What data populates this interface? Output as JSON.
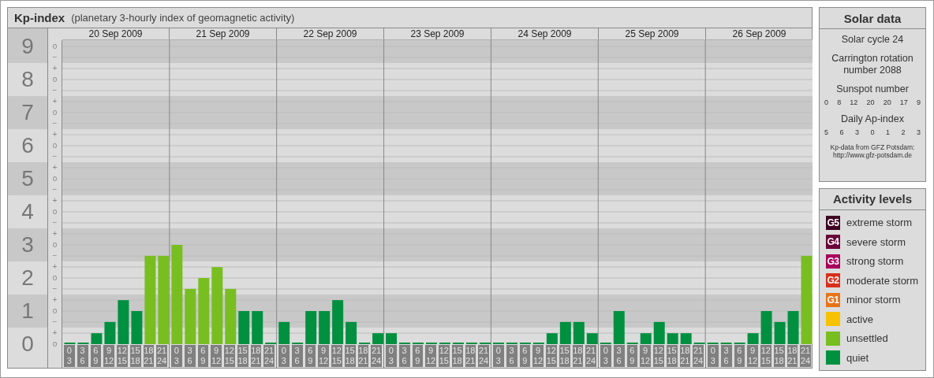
{
  "header": {
    "title": "Kp-index",
    "subtitle": "(planetary 3-hourly index of geomagnetic activity)"
  },
  "chart": {
    "days": [
      {
        "date": "20 Sep 2009"
      },
      {
        "date": "21 Sep 2009"
      },
      {
        "date": "22 Sep 2009"
      },
      {
        "date": "23 Sep 2009"
      },
      {
        "date": "24 Sep 2009"
      },
      {
        "date": "25 Sep 2009"
      },
      {
        "date": "26 Sep 2009"
      }
    ],
    "minor_ticks": [
      "o",
      "−",
      "+",
      "o",
      "−",
      "+",
      "o",
      "−",
      "+",
      "o",
      "−",
      "+",
      "o",
      "−",
      "+",
      "o",
      "−",
      "+",
      "o",
      "−",
      "+",
      "o",
      "−",
      "+",
      "o",
      "−",
      "+",
      "o"
    ],
    "chart_data": {
      "type": "bar",
      "ylim": [
        0,
        9
      ],
      "grid": true,
      "bands": [
        {
          "axis": "y",
          "from": 8.5,
          "to": 9.19,
          "color": "#c8c8c8"
        },
        {
          "axis": "y",
          "from": 6.5,
          "to": 7.5,
          "color": "#c8c8c8"
        },
        {
          "axis": "y",
          "from": 4.5,
          "to": 5.5,
          "color": "#c8c8c8"
        },
        {
          "axis": "y",
          "from": 2.5,
          "to": 3.5,
          "color": "#c8c8c8"
        },
        {
          "axis": "y",
          "from": 0.5,
          "to": 1.5,
          "color": "#c8c8c8"
        }
      ],
      "yticks": [
        9,
        8,
        7,
        6,
        5,
        4,
        3,
        2,
        1,
        0
      ],
      "categories": [
        "0\n3",
        "3\n6",
        "6\n9",
        "9\n12",
        "12\n15",
        "15\n18",
        "18\n21",
        "21\n24",
        "0\n3",
        "3\n6",
        "6\n9",
        "9\n12",
        "12\n15",
        "15\n18",
        "18\n21",
        "21\n24",
        "0\n3",
        "3\n6",
        "6\n9",
        "9\n12",
        "12\n15",
        "15\n18",
        "18\n21",
        "21\n24",
        "0\n3",
        "3\n6",
        "6\n9",
        "9\n12",
        "12\n15",
        "15\n18",
        "18\n21",
        "21\n24",
        "0\n3",
        "3\n6",
        "6\n9",
        "9\n12",
        "12\n15",
        "15\n18",
        "18\n21",
        "21\n24",
        "0\n3",
        "3\n6",
        "6\n9",
        "9\n12",
        "12\n15",
        "15\n18",
        "18\n21",
        "21\n24",
        "0\n3",
        "3\n6",
        "6\n9",
        "9\n12",
        "12\n15",
        "15\n18",
        "18\n21",
        "21\n24"
      ],
      "values": [
        0,
        0,
        0.33,
        0.67,
        1.33,
        1,
        2.67,
        2.67,
        3,
        1.67,
        2,
        2.33,
        1.67,
        1,
        1,
        0,
        0.67,
        0,
        1,
        1,
        1.33,
        0.67,
        0,
        0.33,
        0.33,
        0,
        0,
        0,
        0,
        0,
        0,
        0,
        0,
        0,
        0,
        0,
        0.33,
        0.67,
        0.67,
        0.33,
        0,
        1,
        0,
        0.33,
        0.67,
        0.33,
        0.33,
        0,
        0,
        0,
        0,
        0.33,
        1,
        0.67,
        1,
        2.67
      ]
    }
  },
  "solar": {
    "title": "Solar data",
    "cycle": "Solar cycle 24",
    "rotation": "Carrington rotation number 2088",
    "sunspot_label": "Sunspot number",
    "sunspots": [
      "0",
      "8",
      "12",
      "20",
      "20",
      "17",
      "9"
    ],
    "ap_label": "Daily Ap-index",
    "ap_values": [
      "5",
      "6",
      "3",
      "0",
      "1",
      "2",
      "3"
    ],
    "source": "Kp-data from GFZ Potsdam:",
    "source_url": "http://www.gfz-potsdam.de"
  },
  "legend": {
    "title": "Activity levels",
    "items": [
      {
        "badge": "G5",
        "label": "extreme storm",
        "color": "#3e0022"
      },
      {
        "badge": "G4",
        "label": "severe storm",
        "color": "#680038"
      },
      {
        "badge": "G3",
        "label": "strong storm",
        "color": "#a8005c"
      },
      {
        "badge": "G2",
        "label": "moderate storm",
        "color": "#d8301c"
      },
      {
        "badge": "G1",
        "label": "minor storm",
        "color": "#e8741a"
      },
      {
        "label": "active",
        "color": "#f8c200"
      },
      {
        "label": "unsettled",
        "color": "#78be20"
      },
      {
        "label": "quiet",
        "color": "#009040"
      }
    ]
  }
}
